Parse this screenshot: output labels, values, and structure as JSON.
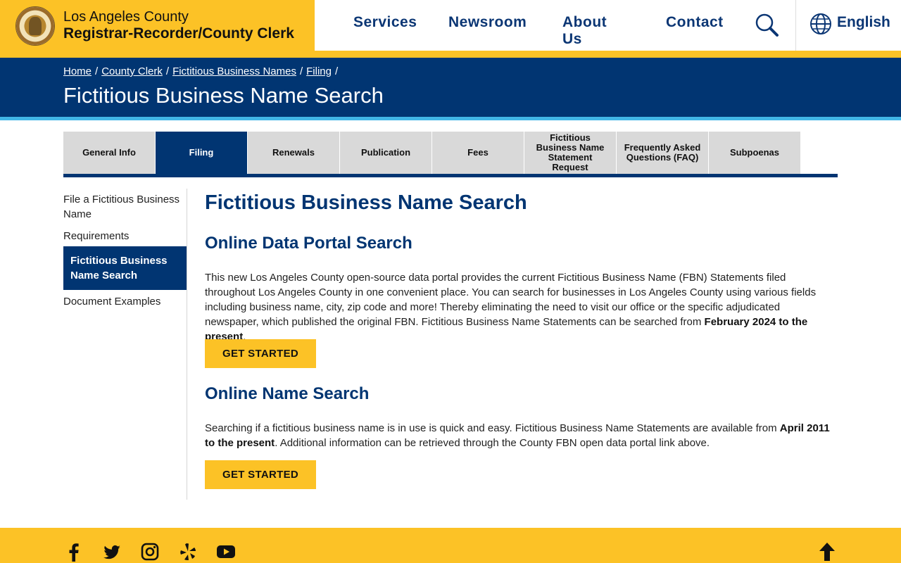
{
  "header": {
    "brand_line1": "Los Angeles County",
    "brand_line2": "Registrar-Recorder/County Clerk",
    "nav": [
      "Services",
      "Newsroom",
      "About Us",
      "Contact"
    ],
    "language": "English",
    "brand_color": "#fcc226",
    "primary_color": "#013572",
    "icons": [
      "county-seal",
      "search-icon",
      "globe-icon"
    ]
  },
  "breadcrumb": {
    "items": [
      "Home",
      "County Clerk",
      "Fictitious Business Names",
      "Filing"
    ],
    "separator": "/"
  },
  "page_title": "Fictitious Business Name Search",
  "tabs": {
    "items": [
      "General Info",
      "Filing",
      "Renewals",
      "Publication",
      "Fees",
      "Fictitious Business Name Statement Request",
      "Frequently Asked Questions (FAQ)",
      "Subpoenas"
    ],
    "active": "Filing"
  },
  "sidebar": {
    "items": [
      "File a Fictitious Business Name",
      "Requirements",
      "Fictitious Business Name Search",
      "Document Examples"
    ],
    "active": "Fictitious Business Name Search"
  },
  "main": {
    "heading": "Fictitious Business Name Search",
    "section1": {
      "title": "Online Data Portal Search",
      "text": "This new Los Angeles County open-source data portal provides the current Fictitious Business Name (FBN) Statements filed throughout Los Angeles County in one convenient place. You can search for businesses in Los Angeles County using various fields including business name, city, zip code and more! Thereby eliminating the need to visit our office or the specific adjudicated newspaper, which published the original FBN. Fictitious Business Name Statements can be searched from ",
      "text_bold": "February 2024 to the present",
      "text_end": ".",
      "button": "GET STARTED"
    },
    "section2": {
      "title": "Online Name Search",
      "text": "Searching if a fictitious business name is in use is quick and easy. Fictitious Business Name Statements are available from ",
      "text_bold": "April 2011 to the present",
      "text_end": ". Additional information can be retrieved through the County FBN open data portal link above.",
      "button": "GET STARTED"
    }
  },
  "footer": {
    "social_icons": [
      "facebook-icon",
      "twitter-icon",
      "instagram-icon",
      "yelp-icon",
      "youtube-icon"
    ],
    "back_to_top_icon": "arrow-up-icon"
  }
}
